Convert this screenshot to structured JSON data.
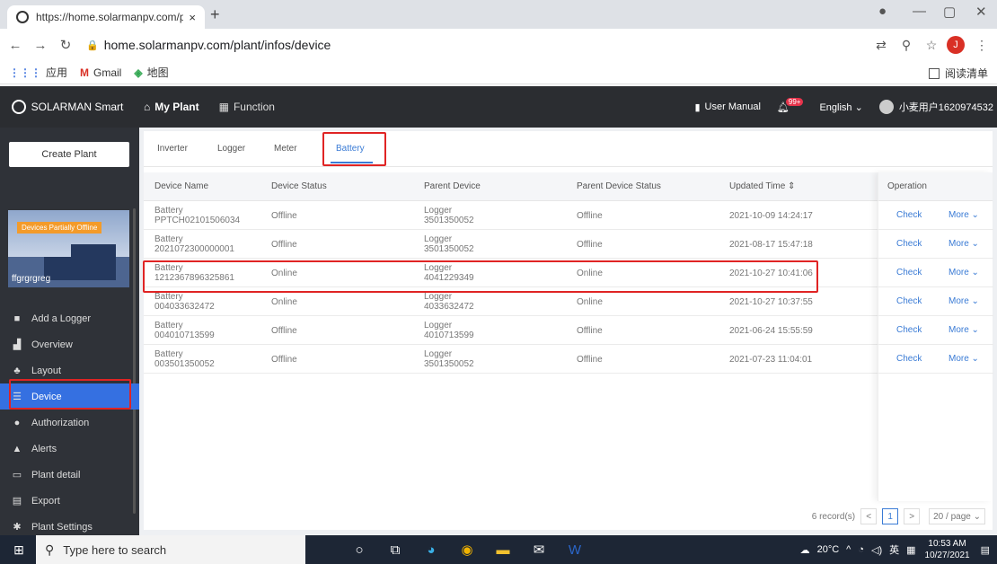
{
  "browser": {
    "tab_title": "https://home.solarmanpv.com/pl",
    "tab_close": "×",
    "new_tab": "+",
    "url": "home.solarmanpv.com/plant/infos/device",
    "bookmarks": [
      {
        "icon": "apps-icon",
        "label": "应用"
      },
      {
        "icon": "gmail-icon",
        "label": "Gmail"
      },
      {
        "icon": "maps-icon",
        "label": "地图"
      }
    ],
    "reading_list": "阅读清单",
    "profile_initial": "J"
  },
  "header": {
    "brand": "SOLARMAN Smart",
    "nav": [
      {
        "label": "My Plant"
      },
      {
        "label": "Function"
      }
    ],
    "user_manual": "User Manual",
    "badge": "99+",
    "language": "English ⌄",
    "username": "小麦用户1620974532"
  },
  "sidebar": {
    "create_plant": "Create Plant",
    "plant_status": "Devices Partially Offline",
    "plant_name": "ffgrgrgreg",
    "items": [
      {
        "label": "Add a Logger",
        "icon": "■"
      },
      {
        "label": "Overview",
        "icon": "▟"
      },
      {
        "label": "Layout",
        "icon": "♣"
      },
      {
        "label": "Device",
        "icon": "☰"
      },
      {
        "label": "Authorization",
        "icon": "●"
      },
      {
        "label": "Alerts",
        "icon": "▲"
      },
      {
        "label": "Plant detail",
        "icon": "▭"
      },
      {
        "label": "Export",
        "icon": "▤"
      },
      {
        "label": "Plant Settings",
        "icon": "✱"
      }
    ]
  },
  "tabs": [
    "Inverter",
    "Logger",
    "Meter",
    "Battery"
  ],
  "table": {
    "headers": [
      "Device Name",
      "Device Status",
      "Parent Device",
      "Parent Device Status",
      "Updated Time ⇕",
      "Operation"
    ],
    "rows": [
      {
        "type": "Battery",
        "sn": "PPTCH02101506034",
        "status": "Offline",
        "ptype": "Logger",
        "psn": "3501350052",
        "pstatus": "Offline",
        "time": "2021-10-09 14:24:17"
      },
      {
        "type": "Battery",
        "sn": "2021072300000001",
        "status": "Offline",
        "ptype": "Logger",
        "psn": "3501350052",
        "pstatus": "Offline",
        "time": "2021-08-17 15:47:18"
      },
      {
        "type": "Battery",
        "sn": "1212367896325861",
        "status": "Online",
        "ptype": "Logger",
        "psn": "4041229349",
        "pstatus": "Online",
        "time": "2021-10-27 10:41:06"
      },
      {
        "type": "Battery",
        "sn": "004033632472",
        "status": "Online",
        "ptype": "Logger",
        "psn": "4033632472",
        "pstatus": "Online",
        "time": "2021-10-27 10:37:55"
      },
      {
        "type": "Battery",
        "sn": "004010713599",
        "status": "Offline",
        "ptype": "Logger",
        "psn": "4010713599",
        "pstatus": "Offline",
        "time": "2021-06-24 15:55:59"
      },
      {
        "type": "Battery",
        "sn": "003501350052",
        "status": "Offline",
        "ptype": "Logger",
        "psn": "3501350052",
        "pstatus": "Offline",
        "time": "2021-07-23 11:04:01"
      }
    ],
    "check": "Check",
    "more": "More ⌄"
  },
  "pager": {
    "records": "6 record(s)",
    "prev": "<",
    "page": "1",
    "next": ">",
    "size": "20 / page ⌄"
  },
  "taskbar": {
    "search_placeholder": "Type here to search",
    "weather": "20°C",
    "ime": "英",
    "time": "10:53 AM",
    "date": "10/27/2021"
  },
  "colors": {
    "accent": "#3a7bd5",
    "highlight": "#e02424",
    "sidebar_active": "#3570e1"
  }
}
